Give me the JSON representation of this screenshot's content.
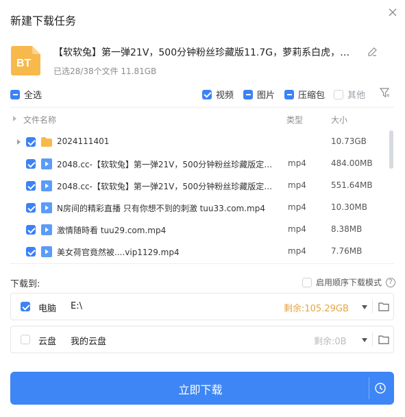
{
  "dialog": {
    "title": "新建下载任务"
  },
  "task": {
    "icon_label": "BT",
    "name": "【软软兔】第一弹21V，500分钟粉丝珍藏版11.7G，萝莉系白虎，户外…",
    "summary": "已选28/38个文件 11.81GB"
  },
  "filters": {
    "select_all": "全选",
    "video": "视频",
    "image": "图片",
    "archive": "压缩包",
    "other": "其他"
  },
  "columns": {
    "name": "文件名称",
    "type": "类型",
    "size": "大小"
  },
  "files": [
    {
      "name": "2024111401",
      "type": "",
      "size": "10.73GB",
      "kind": "folder"
    },
    {
      "name": "2048.cc-【软软兔】第一弹21V，500分钟粉丝珍藏版定制…",
      "type": "mp4",
      "size": "484.00MB",
      "kind": "video"
    },
    {
      "name": "2048.cc-【软软兔】第一弹21V，500分钟粉丝珍藏版定制…",
      "type": "mp4",
      "size": "551.64MB",
      "kind": "video"
    },
    {
      "name": "N房间的精彩直播 只有你想不到的刺激 tuu33.com.mp4",
      "type": "mp4",
      "size": "10.30MB",
      "kind": "video"
    },
    {
      "name": "激情随時看 tuu29.com.mp4",
      "type": "mp4",
      "size": "8.38MB",
      "kind": "video"
    },
    {
      "name": "美女荷官竟然被....vip1129.mp4",
      "type": "mp4",
      "size": "7.76MB",
      "kind": "video"
    }
  ],
  "download": {
    "label": "下载到:",
    "sequential": "启用顺序下载模式",
    "help": "?",
    "targets": [
      {
        "name": "电脑",
        "path": "E:\\",
        "free": "剩余:105.29GB",
        "free_color": "#e8a33c"
      },
      {
        "name": "云盘",
        "path": "我的云盘",
        "free": "剩余:0B",
        "free_color": "#b8bcc2"
      }
    ],
    "button": "立即下载"
  },
  "colors": {
    "accent": "#3e86f5",
    "folder": "#f7b94c",
    "bt_icon": "#f7b94c"
  }
}
